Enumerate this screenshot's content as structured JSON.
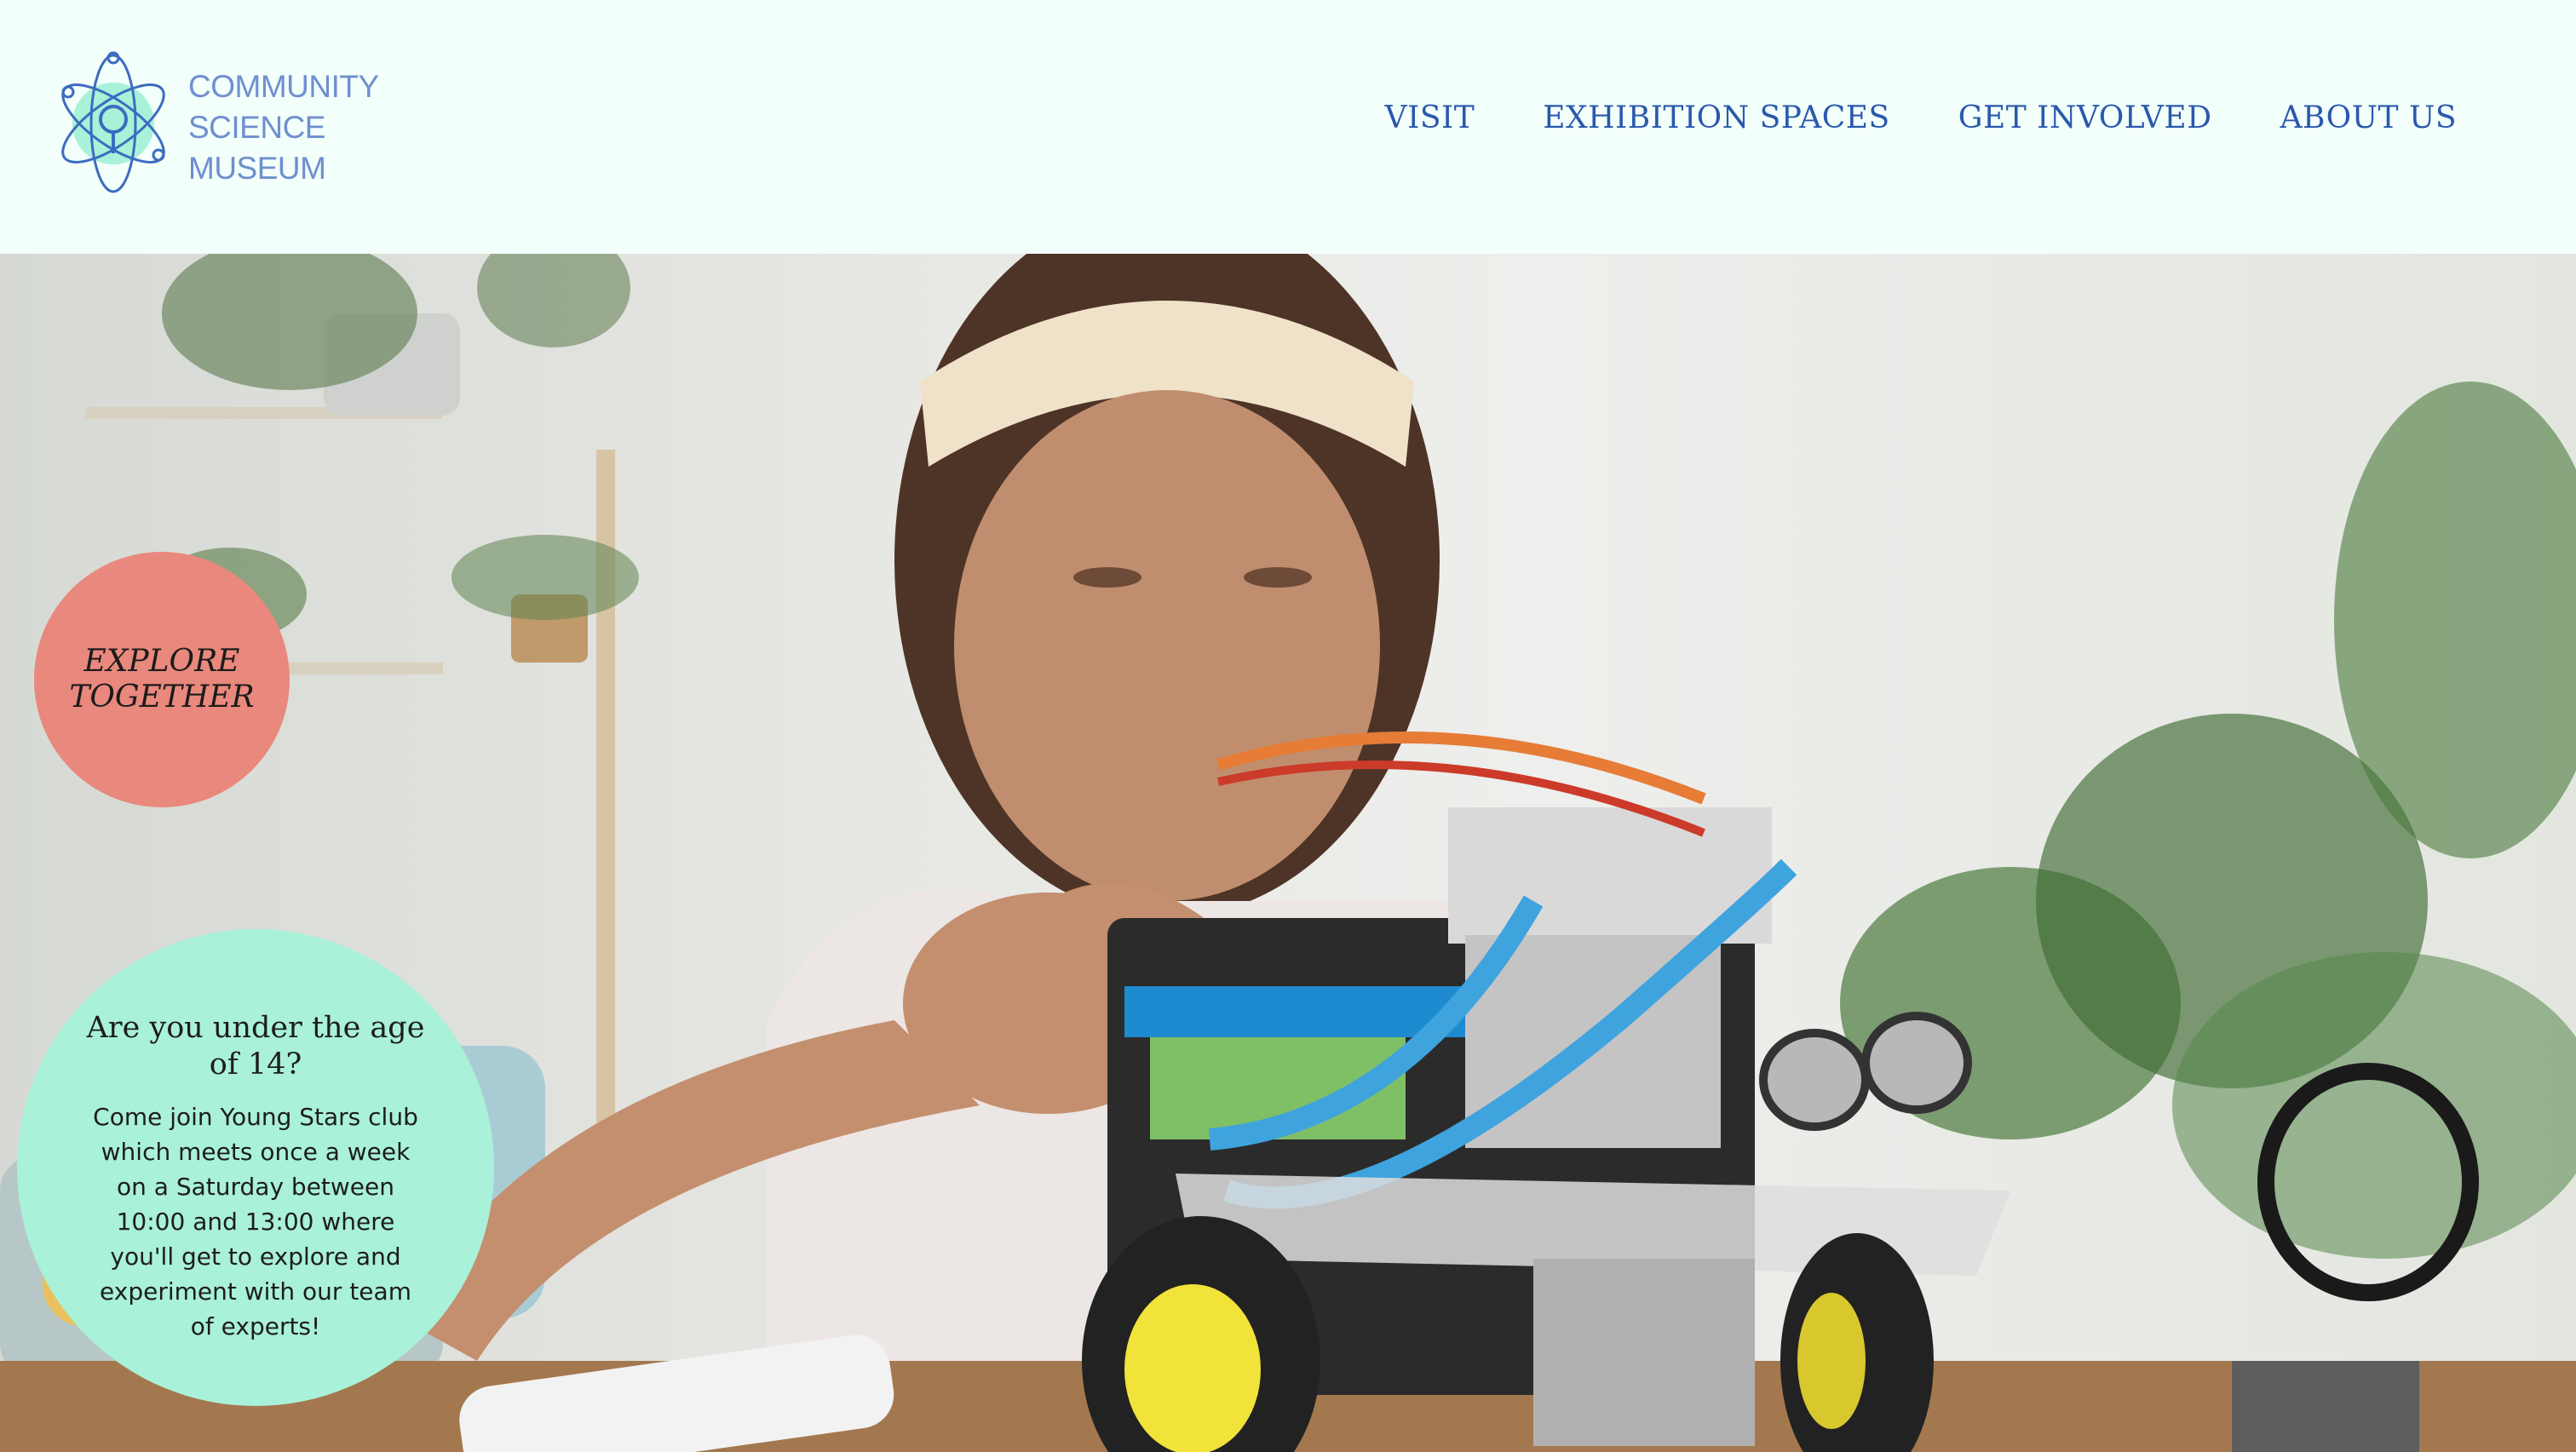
{
  "logo": {
    "line1": "COMMUNITY",
    "line2": "SCIENCE",
    "line3": "MUSEUM",
    "icon": "atom-magnifier-icon"
  },
  "nav": {
    "items": [
      {
        "label": "VISIT"
      },
      {
        "label": "EXHIBITION SPACES"
      },
      {
        "label": "GET INVOLVED"
      },
      {
        "label": "ABOUT US"
      }
    ]
  },
  "hero": {
    "image": "girl-building-robot-car-photo",
    "badge": "EXPLORE\nTOGETHER",
    "promo_title": "Are you under the age of 14?",
    "promo_body": "Come join Young Stars club which meets once a week on a Saturday between 10:00 and 13:00 where you'll get to explore and experiment with our team of experts!"
  },
  "colors": {
    "background": "#f2fffa",
    "nav_text": "#2a58ad",
    "logo_text": "#6f8fcf",
    "badge": "#e9887c",
    "promo_circle": "#a9f1d9"
  }
}
